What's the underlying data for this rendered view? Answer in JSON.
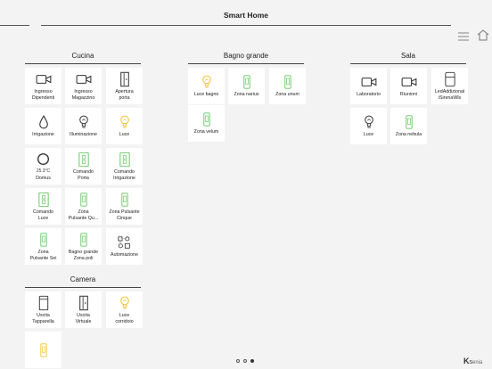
{
  "app": {
    "title": "Smart Home",
    "logo": "ksenia"
  },
  "colors": {
    "accent_yellow": "#f2c12e",
    "accent_green": "#5ec65a",
    "icon_dark": "#333333"
  },
  "pager": {
    "pages": 3,
    "current": 3
  },
  "rooms": [
    {
      "name": "Cucina",
      "tiles": [
        {
          "label": "Ingresso\nDipendenti",
          "icon": "camera-icon"
        },
        {
          "label": "Ingresso\nMagazzino",
          "icon": "camera-icon"
        },
        {
          "label": "Apertura\nporta",
          "icon": "door-icon"
        },
        {
          "label": "Irrigazione",
          "icon": "water-drop-icon"
        },
        {
          "label": "Illuminazione",
          "icon": "lightbulb-off-icon"
        },
        {
          "label": "Luce",
          "icon": "lightbulb-on-icon"
        },
        {
          "label": "Domus",
          "icon": "thermostat-icon",
          "value": "25.3°C"
        },
        {
          "label": "Comando\nPorta",
          "icon": "switch-panel-icon"
        },
        {
          "label": "Comando\nIrrigazione",
          "icon": "switch-panel-icon"
        },
        {
          "label": "Comando\nLuce",
          "icon": "switch-panel-icon"
        },
        {
          "label": "Zona\nPulsante Qu...",
          "icon": "switch-green-icon"
        },
        {
          "label": "Zona Pulsante\nCinque",
          "icon": "switch-green-icon"
        },
        {
          "label": "Zona\nPulsante Sei",
          "icon": "switch-green-icon"
        },
        {
          "label": "Bagno grande\nZona poli",
          "icon": "switch-green-icon"
        },
        {
          "label": "Automazione",
          "icon": "automation-icon"
        }
      ]
    },
    {
      "name": "Bagno grande",
      "tiles": [
        {
          "label": "Luce bagno",
          "icon": "lightbulb-on-icon"
        },
        {
          "label": "Zona narius",
          "icon": "switch-green-icon"
        },
        {
          "label": "Zona unum",
          "icon": "switch-green-icon"
        },
        {
          "label": "Zona velum",
          "icon": "switch-green-icon"
        }
      ]
    },
    {
      "name": "Sala",
      "tiles": [
        {
          "label": "Laboratorio",
          "icon": "camera-icon"
        },
        {
          "label": "Riunioni",
          "icon": "camera-icon"
        },
        {
          "label": "LedAddizional\niSirenaWls",
          "icon": "siren-icon"
        },
        {
          "label": "Luce",
          "icon": "lightbulb-off-icon"
        },
        {
          "label": "Zona nebula",
          "icon": "switch-green-icon"
        }
      ]
    },
    {
      "name": "Camera",
      "tiles": [
        {
          "label": "Uscita\nTapparella",
          "icon": "shutter-icon"
        },
        {
          "label": "Uscita\nVirtuale",
          "icon": "door-icon"
        },
        {
          "label": "Luce\ncorridoio",
          "icon": "lightbulb-on-icon"
        },
        {
          "label": "",
          "icon": "switch-yellow-icon"
        }
      ]
    }
  ]
}
